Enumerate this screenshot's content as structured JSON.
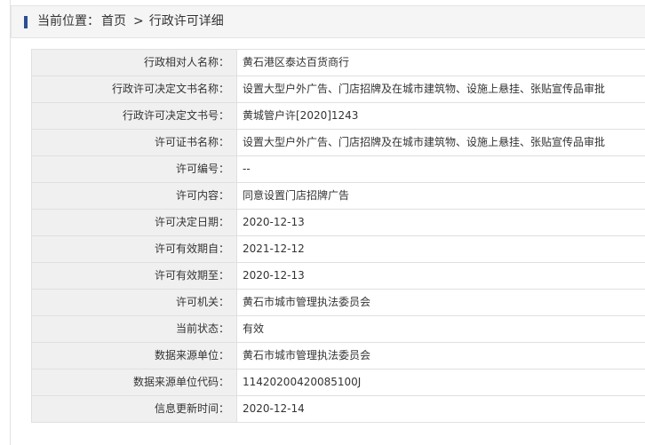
{
  "breadcrumb": {
    "prefix": "当前位置：",
    "home": "首页",
    "separator": ">",
    "current": "行政许可详细"
  },
  "rows": [
    {
      "label": "行政相对人名称：",
      "value": "黄石港区泰达百货商行"
    },
    {
      "label": "行政许可决定文书名称：",
      "value": "设置大型户外广告、门店招牌及在城市建筑物、设施上悬挂、张贴宣传品审批"
    },
    {
      "label": "行政许可决定文书号：",
      "value": "黄城管户许[2020]1243"
    },
    {
      "label": "许可证书名称：",
      "value": "设置大型户外广告、门店招牌及在城市建筑物、设施上悬挂、张贴宣传品审批"
    },
    {
      "label": "许可编号：",
      "value": "--"
    },
    {
      "label": "许可内容：",
      "value": "同意设置门店招牌广告"
    },
    {
      "label": "许可决定日期：",
      "value": "2020-12-13"
    },
    {
      "label": "许可有效期自：",
      "value": "2021-12-12"
    },
    {
      "label": "许可有效期至：",
      "value": "2020-12-13"
    },
    {
      "label": "许可机关：",
      "value": "黄石市城市管理执法委员会"
    },
    {
      "label": "当前状态：",
      "value": "有效"
    },
    {
      "label": "数据来源单位：",
      "value": "黄石市城市管理执法委员会"
    },
    {
      "label": "数据来源单位代码：",
      "value": "11420200420085100J"
    },
    {
      "label": "信息更新时间：",
      "value": "2020-12-14"
    }
  ],
  "colors": {
    "accent": "#2b4f93",
    "label_bg": "#f0f0f0",
    "border": "#e0e0e0"
  }
}
